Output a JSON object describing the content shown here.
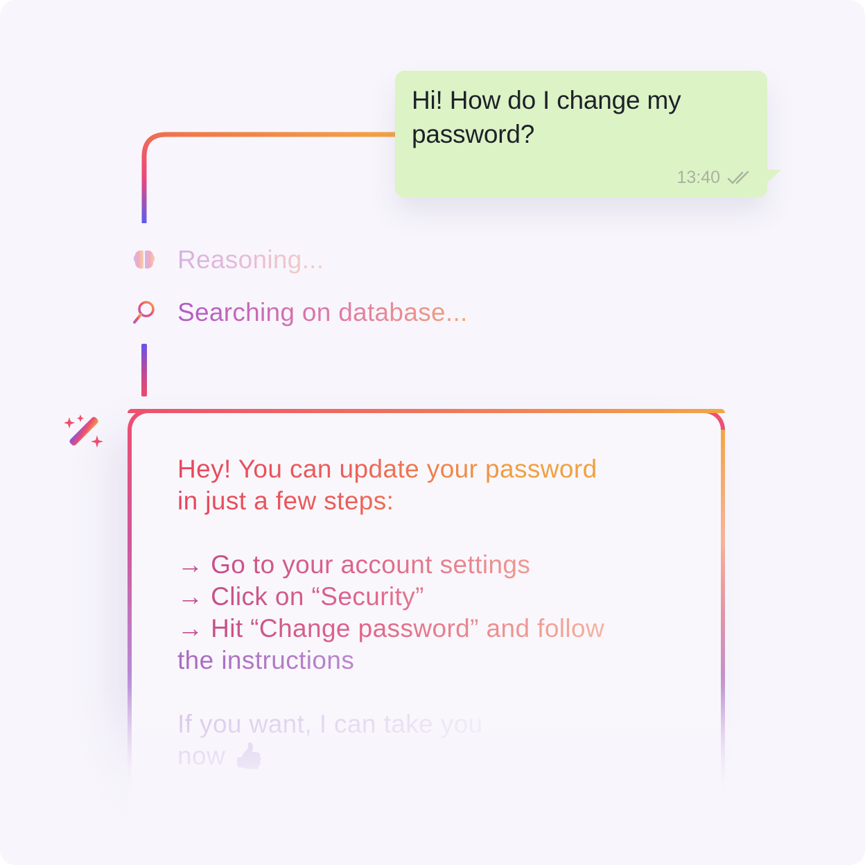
{
  "user_message": {
    "line1": "Hi! How do I change my",
    "line2": "password?",
    "time": "13:40",
    "status_icon": "double-check-icon",
    "bubble_color": "#dcf3c5"
  },
  "status": {
    "reasoning": {
      "label": "Reasoning...",
      "icon": "brain-icon"
    },
    "searching": {
      "label": "Searching on database...",
      "icon": "search-icon"
    }
  },
  "ai_response": {
    "icon": "magic-wand-icon",
    "intro_line1": "Hey! You can update your password",
    "intro_line2": "in just a few steps:",
    "step1": "→ Go to your account settings",
    "step2": "→ Click on “Security”",
    "step3": "→ Hit “Change password” and follow",
    "step3_cont": "the instructions",
    "closing_line1": "If you want, I can take you",
    "closing_line2": "now 👍"
  },
  "colors": {
    "accent_pink": "#ef4f6f",
    "accent_orange": "#f3a547",
    "accent_purple": "#6653ee",
    "background": "#f8f6fc"
  }
}
